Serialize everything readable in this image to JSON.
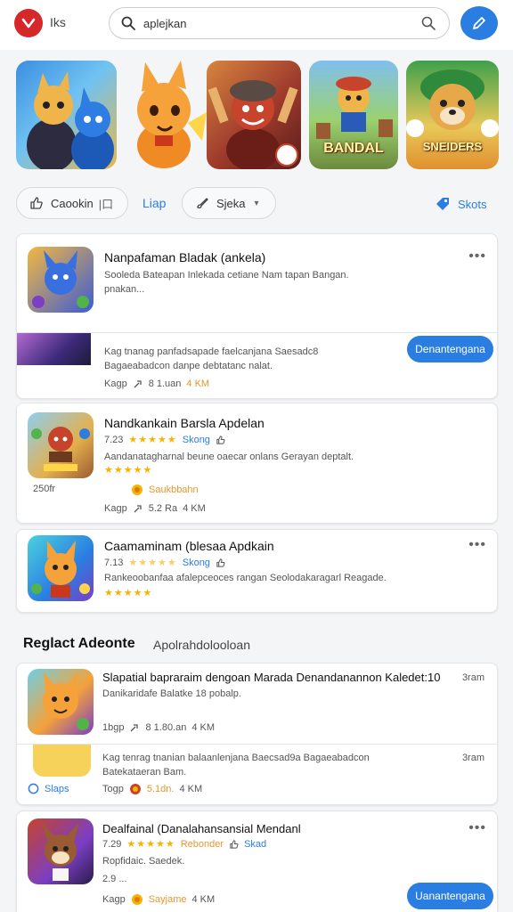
{
  "header": {
    "logo_text": "Iks",
    "search_value": "aplejkan"
  },
  "banners": [
    {
      "name": "Banner hero blue duo"
    },
    {
      "name": "Banner orange fox"
    },
    {
      "name": "Banner red warrior"
    },
    {
      "name": "Banner game",
      "title": "BANDAL"
    },
    {
      "name": "Banner dog",
      "title": "SNEIDERS"
    }
  ],
  "chips": {
    "chip1_label": "Caookin",
    "chip1_tail": "|口",
    "link_label": "Liap",
    "chip2_label": "Sjeka",
    "chip2_caret": "▾",
    "stories_label": "Skots"
  },
  "cards": {
    "c1": {
      "title": "Nanpafaman Bladak (ankela)",
      "desc": "Sooleda Bateapan Inlekada cetiane Nam tapan Bangan. pnakan...",
      "promo_desc": "Kag tnanag panfadsapade faelcanjana Saesadc8 Bagaeabadcon danpe debtatanc nalat.",
      "meta_a": "Kagp",
      "meta_b": "8 1.uan",
      "meta_c": "4 KM",
      "button": "Denantengana",
      "dots": "•••"
    },
    "c2": {
      "title": "Nandkankain Barsla Apdelan",
      "rating": "7.23",
      "stars": "★★★★★",
      "tag": "Skong",
      "desc": "Aandanatagharnal beune oaecar onlans Gerayan deptalt.",
      "stars2": "★★★★★",
      "price": "250fr",
      "seller": "Saukbbahn",
      "meta_a": "Kagp",
      "meta_b": "5.2 Ra",
      "meta_c": "4 KM",
      "dots": "•••"
    },
    "c3": {
      "title": "Caamaminam (blesaa Apdkain",
      "rating": "7.13",
      "stars": "★★★★★",
      "tag": "Skong",
      "desc": "Rankeoobanfaa afalepceoces rangan Seolodakaragarl Reagade.",
      "stars2": "★★★★★",
      "dots": "•••"
    },
    "c4": {
      "title": "Slapatial bapraraim dengoan Marada Denandanannon Kaledet:10",
      "time": "3ram",
      "desc": "Danikaridafe Balatke 18 pobalp.",
      "meta_a": "1bgp",
      "meta_b": "8 1.80.an",
      "meta_c": "4 KM",
      "promo_desc": "Kag tenrag tnanian balaanlenjana Baecsad9a Bagaeabadcon Batekataeran Bam.",
      "promo_time": "3ram",
      "promo_link": "Slaps",
      "promo_meta_a": "Togp",
      "promo_meta_b": "5.1dn.",
      "promo_meta_c": "4 KM"
    },
    "c5": {
      "title": "Dealfainal (Danalahansansial Mendanl",
      "rating": "7.29",
      "stars": "★★★★★",
      "tag": "Rebonder",
      "tag2": "Skad",
      "desc": "Ropfidaic. Saedek.",
      "price": "2.9 ...",
      "seller": "Sayjame",
      "meta_a": "Kagp",
      "meta_c": "4 KM",
      "button": "Uanantengana",
      "dots": "•••"
    }
  },
  "section": {
    "title": "Reglact Adeonte",
    "subtitle": "Apolrahdolooloan"
  },
  "colors": {
    "accent": "#2a7de1",
    "brand_red": "#d62828",
    "star": "#f4b400"
  }
}
